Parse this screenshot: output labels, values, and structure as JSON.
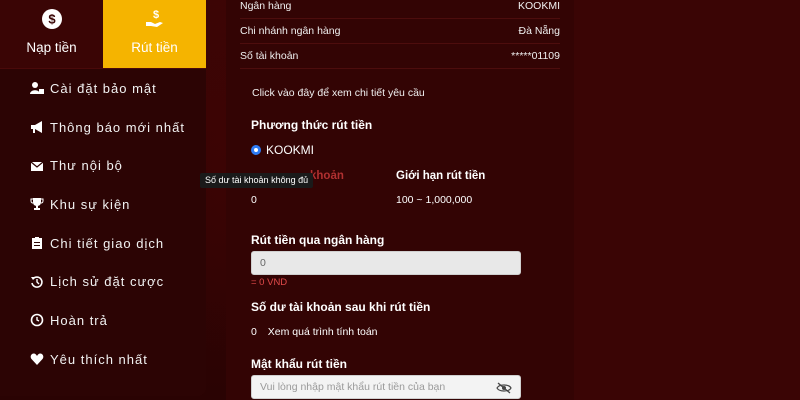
{
  "tabs": {
    "deposit_label": "Nạp tiền",
    "withdraw_label": "Rút tiền",
    "deposit_icon": "money-bag-icon",
    "withdraw_icon": "hand-money-icon",
    "active_color": "#f5b400"
  },
  "menu": [
    {
      "label": "Cài đặt bảo mật",
      "icon": "user-lock-icon"
    },
    {
      "label": "Thông báo mới nhất",
      "icon": "megaphone-icon"
    },
    {
      "label": "Thư nội bộ",
      "icon": "envelope-icon"
    },
    {
      "label": "Khu sự kiện",
      "icon": "trophy-icon"
    },
    {
      "label": "Chi tiết giao dịch",
      "icon": "clipboard-icon"
    },
    {
      "label": "Lịch sử đặt cược",
      "icon": "history-icon"
    },
    {
      "label": "Hoàn trả",
      "icon": "refund-icon"
    },
    {
      "label": "Yêu thích nhất",
      "icon": "heart-icon"
    }
  ],
  "bank_info": [
    {
      "label": "Ngân hàng",
      "value": "KOOKMI"
    },
    {
      "label": "Chi nhánh ngân hàng",
      "value": "Đà Nẵng"
    },
    {
      "label": "Số tài khoản",
      "value": "*****01109"
    }
  ],
  "detail_link": "Click vào đây để xem chi tiết yêu cầu",
  "withdraw_method": {
    "title": "Phương thức rút tiền",
    "option": "KOOKMI"
  },
  "balance": {
    "label_partial": "khoản",
    "value": "0",
    "limit_label": "Giới hạn rút tiền",
    "limit_value": "100 ~ 1,000,000"
  },
  "tooltip": "Số dư tài khoản không đủ",
  "bank_withdraw": {
    "title": "Rút tiền qua ngân hàng",
    "input_value": "0",
    "vnd_note": "= 0 VND"
  },
  "after_balance": {
    "title": "Số dư tài khoản sau khi rút tiền",
    "value": "0",
    "note": "Xem quá trình tính toán"
  },
  "password": {
    "title": "Mật khẩu rút tiền",
    "placeholder": "Vui lòng nhập mật khẩu rút tiền của bạn",
    "icon": "eye-slash-icon"
  }
}
